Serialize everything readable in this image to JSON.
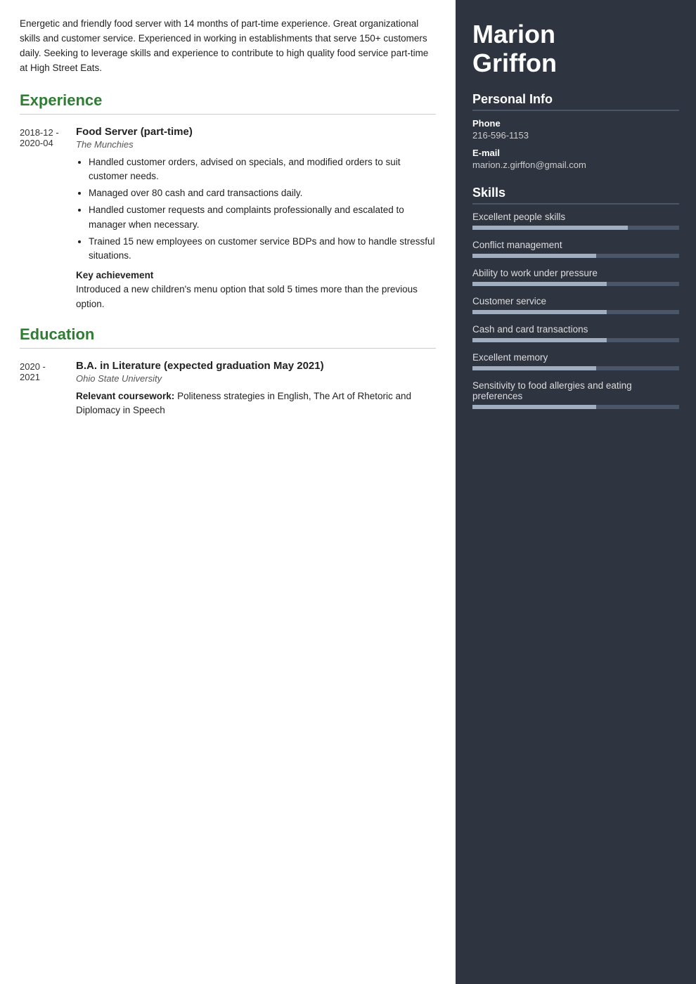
{
  "left": {
    "summary": "Energetic and friendly food server with 14 months of part-time experience. Great organizational skills and customer service. Experienced in working in establishments that serve 150+ customers daily. Seeking to leverage skills and experience to contribute to high quality food service part-time at High Street Eats.",
    "experience_section_label": "Experience",
    "experience_entries": [
      {
        "date": "2018-12 -\n2020-04",
        "title": "Food Server (part-time)",
        "company": "The Munchies",
        "bullets": [
          "Handled customer orders, advised on specials, and modified orders to suit customer needs.",
          "Managed over 80 cash and card transactions daily.",
          "Handled customer requests and complaints professionally and escalated to manager when necessary.",
          "Trained 15 new employees on customer service BDPs and how to handle stressful situations."
        ],
        "key_achievement_label": "Key achievement",
        "key_achievement_text": "Introduced a new children's menu option that sold 5 times more than the previous option."
      }
    ],
    "education_section_label": "Education",
    "education_entries": [
      {
        "date": "2020 -\n2021",
        "title": "B.A. in Literature (expected graduation May 2021)",
        "institution": "Ohio State University",
        "coursework_label": "Relevant coursework:",
        "coursework_text": "Politeness strategies in English, The Art of Rhetoric and Diplomacy in Speech"
      }
    ]
  },
  "right": {
    "name": "Marion\nGriffon",
    "personal_info_section_label": "Personal Info",
    "phone_label": "Phone",
    "phone_value": "216-596-1153",
    "email_label": "E-mail",
    "email_value": "marion.z.girffon@gmail.com",
    "skills_section_label": "Skills",
    "skills": [
      {
        "name": "Excellent people skills",
        "filled": 75,
        "total": 100
      },
      {
        "name": "Conflict management",
        "filled": 60,
        "total": 100
      },
      {
        "name": "Ability to work under pressure",
        "filled": 65,
        "total": 100
      },
      {
        "name": "Customer service",
        "filled": 65,
        "total": 100
      },
      {
        "name": "Cash and card transactions",
        "filled": 65,
        "total": 100
      },
      {
        "name": "Excellent memory",
        "filled": 60,
        "total": 100
      },
      {
        "name": "Sensitivity to food allergies and eating preferences",
        "filled": 60,
        "total": 100
      }
    ]
  }
}
